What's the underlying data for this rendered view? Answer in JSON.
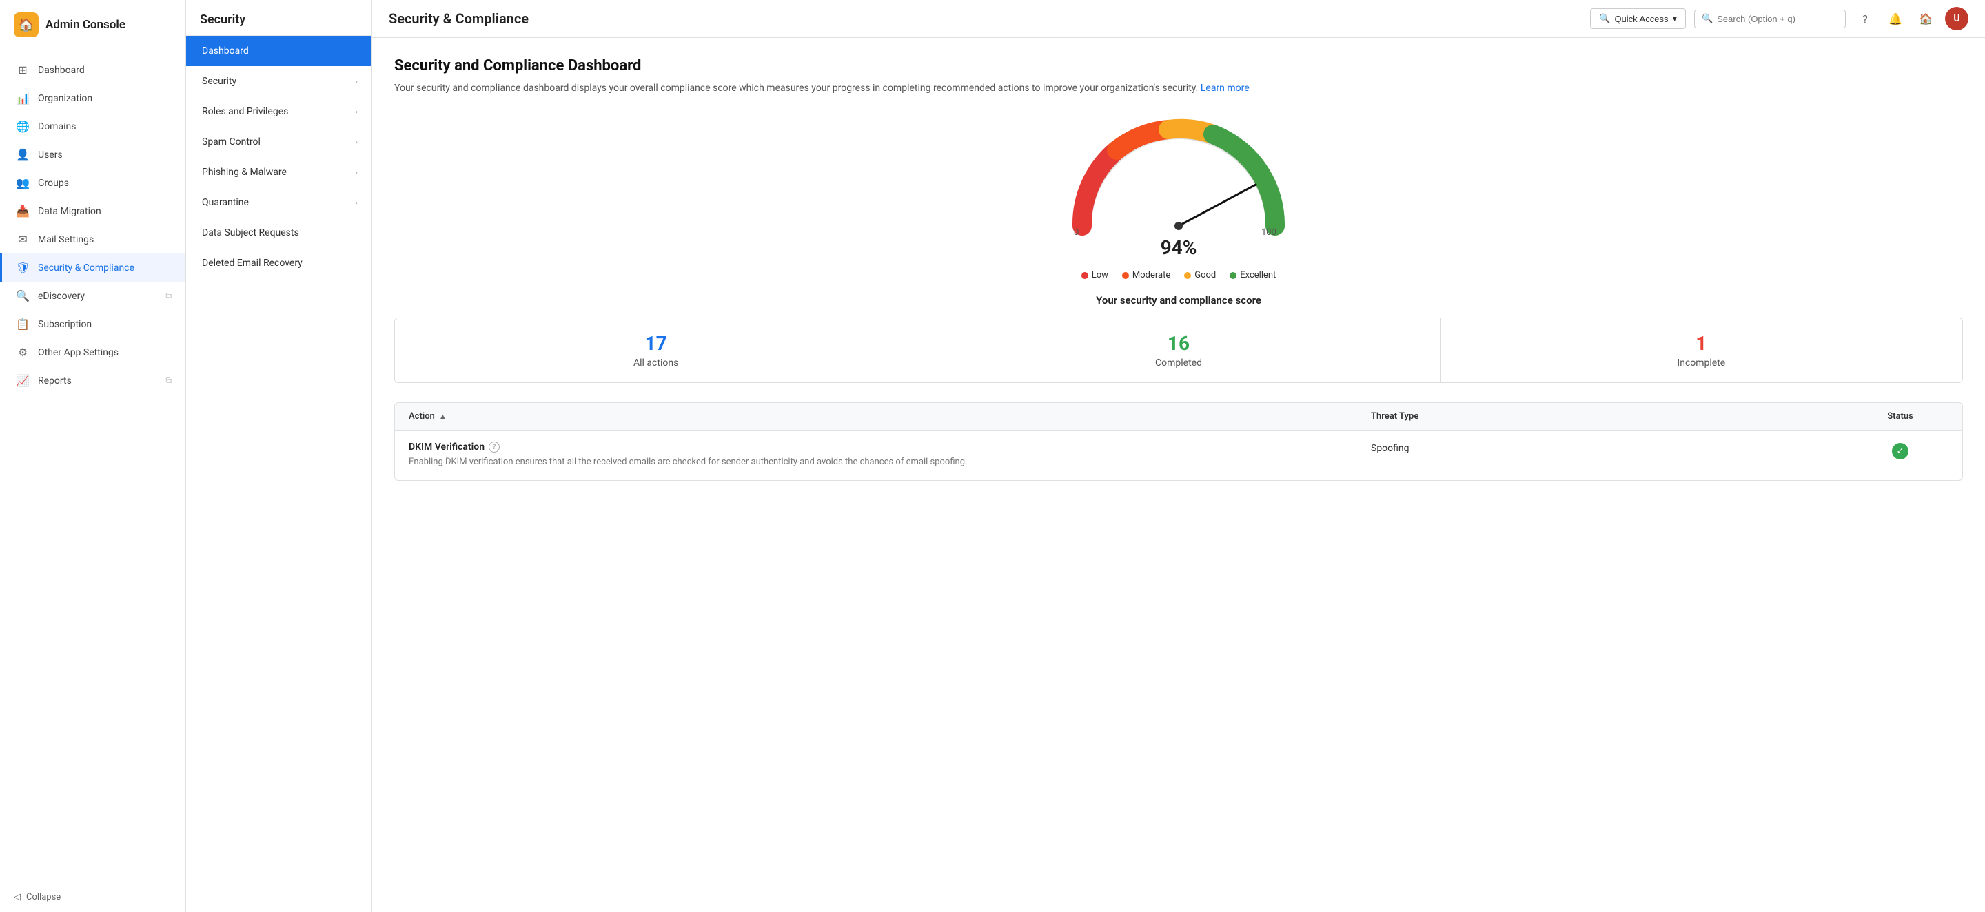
{
  "app": {
    "name": "Admin Console",
    "logo_icon": "🏠"
  },
  "sidebar": {
    "items": [
      {
        "id": "dashboard",
        "label": "Dashboard",
        "icon": "⊞"
      },
      {
        "id": "organization",
        "label": "Organization",
        "icon": "📊"
      },
      {
        "id": "domains",
        "label": "Domains",
        "icon": "🌐"
      },
      {
        "id": "users",
        "label": "Users",
        "icon": "👤"
      },
      {
        "id": "groups",
        "label": "Groups",
        "icon": "👥"
      },
      {
        "id": "data-migration",
        "label": "Data Migration",
        "icon": "📥"
      },
      {
        "id": "mail-settings",
        "label": "Mail Settings",
        "icon": "✉"
      },
      {
        "id": "security-compliance",
        "label": "Security & Compliance",
        "icon": "🛡",
        "active": true
      },
      {
        "id": "ediscovery",
        "label": "eDiscovery",
        "icon": "🔍",
        "ext": true
      },
      {
        "id": "subscription",
        "label": "Subscription",
        "icon": "📋"
      },
      {
        "id": "other-app-settings",
        "label": "Other App Settings",
        "icon": "⚙"
      },
      {
        "id": "reports",
        "label": "Reports",
        "icon": "📈",
        "ext": true
      }
    ],
    "collapse_label": "Collapse"
  },
  "sub_nav": {
    "title": "Security",
    "items": [
      {
        "id": "dashboard",
        "label": "Dashboard",
        "active": true,
        "has_arrow": false
      },
      {
        "id": "security",
        "label": "Security",
        "active": false,
        "has_arrow": true
      },
      {
        "id": "roles-privileges",
        "label": "Roles and Privileges",
        "active": false,
        "has_arrow": true
      },
      {
        "id": "spam-control",
        "label": "Spam Control",
        "active": false,
        "has_arrow": true
      },
      {
        "id": "phishing-malware",
        "label": "Phishing & Malware",
        "active": false,
        "has_arrow": true
      },
      {
        "id": "quarantine",
        "label": "Quarantine",
        "active": false,
        "has_arrow": true
      },
      {
        "id": "data-subject-requests",
        "label": "Data Subject Requests",
        "active": false,
        "has_arrow": false
      },
      {
        "id": "deleted-email-recovery",
        "label": "Deleted Email Recovery",
        "active": false,
        "has_arrow": false
      }
    ]
  },
  "topbar": {
    "title": "Security & Compliance",
    "quick_access_label": "Quick Access",
    "search_placeholder": "Search (Option + q)"
  },
  "main": {
    "page_title": "Security and Compliance Dashboard",
    "page_desc": "Your security and compliance dashboard displays your overall compliance score which measures your progress in completing recommended actions to improve your organization's security.",
    "learn_more_label": "Learn more",
    "gauge": {
      "value_label": "94%",
      "min_label": "0",
      "max_label": "100"
    },
    "legend": [
      {
        "id": "low",
        "label": "Low",
        "color": "#e53935"
      },
      {
        "id": "moderate",
        "label": "Moderate",
        "color": "#f4511e"
      },
      {
        "id": "good",
        "label": "Good",
        "color": "#f9a825"
      },
      {
        "id": "excellent",
        "label": "Excellent",
        "color": "#43a047"
      }
    ],
    "score_section_title": "Your security and compliance score",
    "score_cards": [
      {
        "id": "all-actions",
        "num": "17",
        "label": "All actions",
        "color": "blue"
      },
      {
        "id": "completed",
        "num": "16",
        "label": "Completed",
        "color": "green"
      },
      {
        "id": "incomplete",
        "num": "1",
        "label": "Incomplete",
        "color": "red"
      }
    ],
    "table": {
      "columns": [
        {
          "id": "action",
          "label": "Action",
          "sortable": true
        },
        {
          "id": "threat-type",
          "label": "Threat Type"
        },
        {
          "id": "status",
          "label": "Status"
        }
      ],
      "rows": [
        {
          "id": "dkim-verification",
          "title": "DKIM Verification",
          "has_info": true,
          "description": "Enabling DKIM verification ensures that all the received emails are checked for sender authenticity and avoids the chances of email spoofing.",
          "threat_type": "Spoofing",
          "status": "completed"
        }
      ]
    }
  }
}
